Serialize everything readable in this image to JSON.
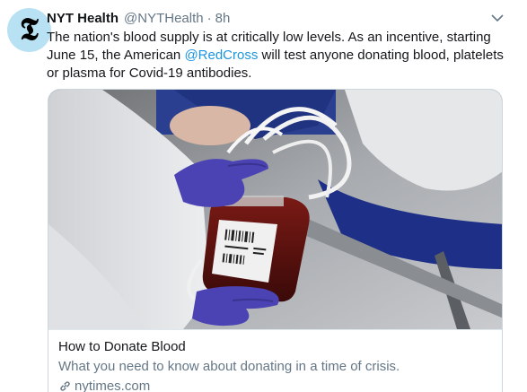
{
  "author": {
    "avatar_glyph": "𝕿",
    "display_name": "NYT Health",
    "handle": "@NYTHealth",
    "separator": "·",
    "time": "8h"
  },
  "tweet": {
    "text_part1": "The nation's blood supply is at critically low levels. As an incentive, starting June 15, the American ",
    "mention": "@RedCross",
    "text_part2": " will test anyone donating blood, platelets or plasma for Covid-19 antibodies."
  },
  "card": {
    "title": "How to Donate Blood",
    "description": "What you need to know about donating in a time of crisis.",
    "domain": "nytimes.com"
  },
  "icons": {
    "menu": "chevron-down-icon",
    "link": "link-icon"
  },
  "colors": {
    "link": "#1b95e0",
    "secondary_text": "#657786",
    "avatar_bg": "#b8e2f3",
    "glove": "#4b43b3",
    "blood": "#5a1210"
  }
}
